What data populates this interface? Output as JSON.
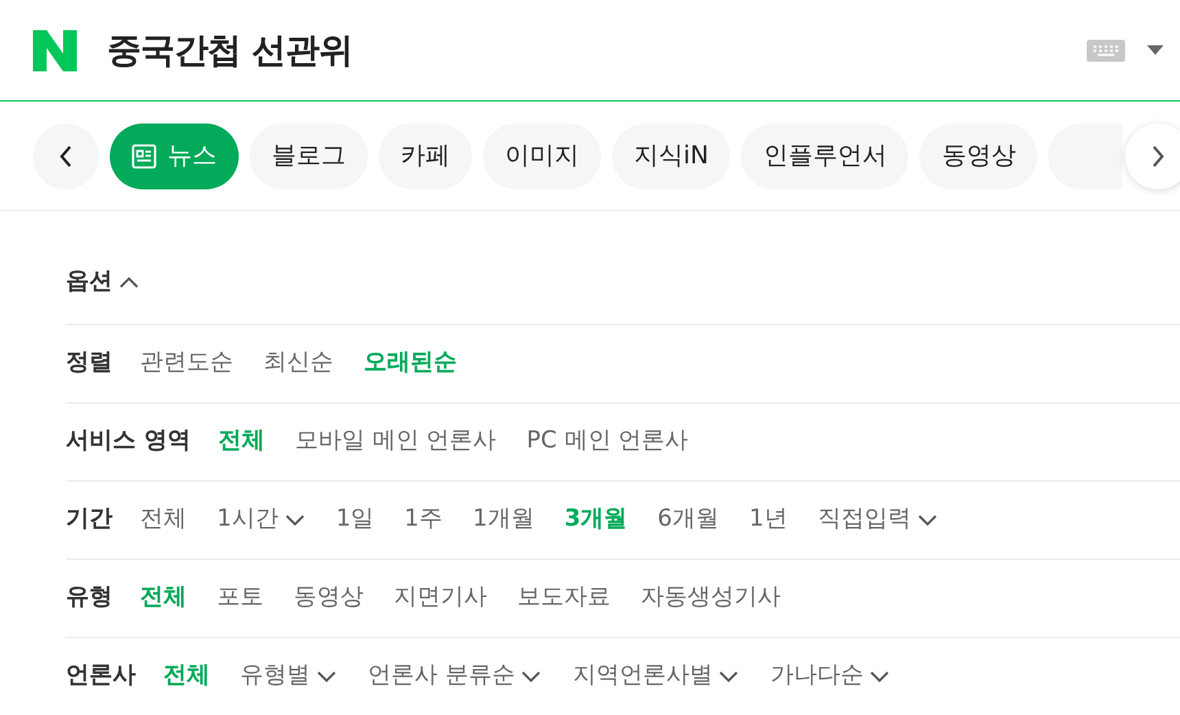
{
  "header": {
    "title": "중국간첩 선관위"
  },
  "tabs": [
    {
      "label": "뉴스",
      "selected": true
    },
    {
      "label": "블로그",
      "selected": false
    },
    {
      "label": "카페",
      "selected": false
    },
    {
      "label": "이미지",
      "selected": false
    },
    {
      "label": "지식iN",
      "selected": false
    },
    {
      "label": "인플루언서",
      "selected": false
    },
    {
      "label": "동영상",
      "selected": false
    }
  ],
  "options": {
    "title": "옵션",
    "expanded": true,
    "rows": [
      {
        "label": "정렬",
        "items": [
          {
            "text": "관련도순",
            "selected": false,
            "dropdown": false
          },
          {
            "text": "최신순",
            "selected": false,
            "dropdown": false
          },
          {
            "text": "오래된순",
            "selected": true,
            "dropdown": false
          }
        ]
      },
      {
        "label": "서비스 영역",
        "items": [
          {
            "text": "전체",
            "selected": true,
            "dropdown": false
          },
          {
            "text": "모바일 메인 언론사",
            "selected": false,
            "dropdown": false
          },
          {
            "text": "PC 메인 언론사",
            "selected": false,
            "dropdown": false
          }
        ]
      },
      {
        "label": "기간",
        "items": [
          {
            "text": "전체",
            "selected": false,
            "dropdown": false
          },
          {
            "text": "1시간",
            "selected": false,
            "dropdown": true
          },
          {
            "text": "1일",
            "selected": false,
            "dropdown": false
          },
          {
            "text": "1주",
            "selected": false,
            "dropdown": false
          },
          {
            "text": "1개월",
            "selected": false,
            "dropdown": false
          },
          {
            "text": "3개월",
            "selected": true,
            "dropdown": false
          },
          {
            "text": "6개월",
            "selected": false,
            "dropdown": false
          },
          {
            "text": "1년",
            "selected": false,
            "dropdown": false
          },
          {
            "text": "직접입력",
            "selected": false,
            "dropdown": true
          }
        ]
      },
      {
        "label": "유형",
        "items": [
          {
            "text": "전체",
            "selected": true,
            "dropdown": false
          },
          {
            "text": "포토",
            "selected": false,
            "dropdown": false
          },
          {
            "text": "동영상",
            "selected": false,
            "dropdown": false
          },
          {
            "text": "지면기사",
            "selected": false,
            "dropdown": false
          },
          {
            "text": "보도자료",
            "selected": false,
            "dropdown": false
          },
          {
            "text": "자동생성기사",
            "selected": false,
            "dropdown": false
          }
        ]
      },
      {
        "label": "언론사",
        "items": [
          {
            "text": "전체",
            "selected": true,
            "dropdown": false
          },
          {
            "text": "유형별",
            "selected": false,
            "dropdown": true
          },
          {
            "text": "언론사 분류순",
            "selected": false,
            "dropdown": true
          },
          {
            "text": "지역언론사별",
            "selected": false,
            "dropdown": true
          },
          {
            "text": "가나다순",
            "selected": false,
            "dropdown": true
          }
        ]
      }
    ]
  }
}
